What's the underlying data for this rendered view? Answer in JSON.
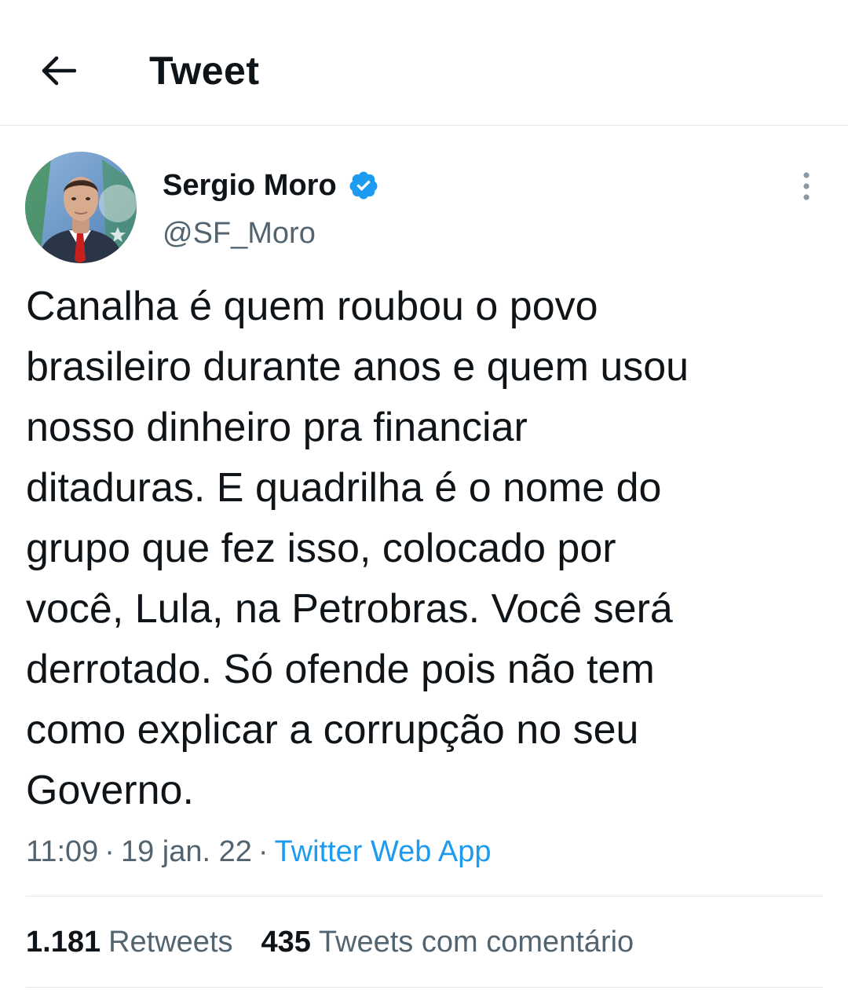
{
  "header": {
    "back_icon": "arrow-left-icon",
    "title": "Tweet"
  },
  "tweet": {
    "author": {
      "display_name": "Sergio Moro",
      "handle": "@SF_Moro",
      "verified": true,
      "verified_icon": "verified-badge-icon",
      "verified_color": "#1d9bf0"
    },
    "more_icon": "more-vertical-icon",
    "text": "Canalha é quem roubou o povo\nbrasileiro durante anos e quem usou\nnosso dinheiro pra financiar\nditaduras. E quadrilha é o nome do\ngrupo que fez isso, colocado por\nvocê, Lula, na Petrobras. Você será\nderrotado. Só ofende pois não tem\ncomo explicar a corrupção no seu\nGoverno.",
    "time": "11:09",
    "separator": "·",
    "date": "19 jan. 22",
    "source": "Twitter Web App"
  },
  "stats": {
    "retweets_count": "1.181",
    "retweets_label": "Retweets",
    "quotes_count": "435",
    "quotes_label": "Tweets com comentário"
  },
  "colors": {
    "text": "#0f1419",
    "secondary": "#536471",
    "link": "#1d9bf0",
    "divider": "#e1e6ea"
  }
}
